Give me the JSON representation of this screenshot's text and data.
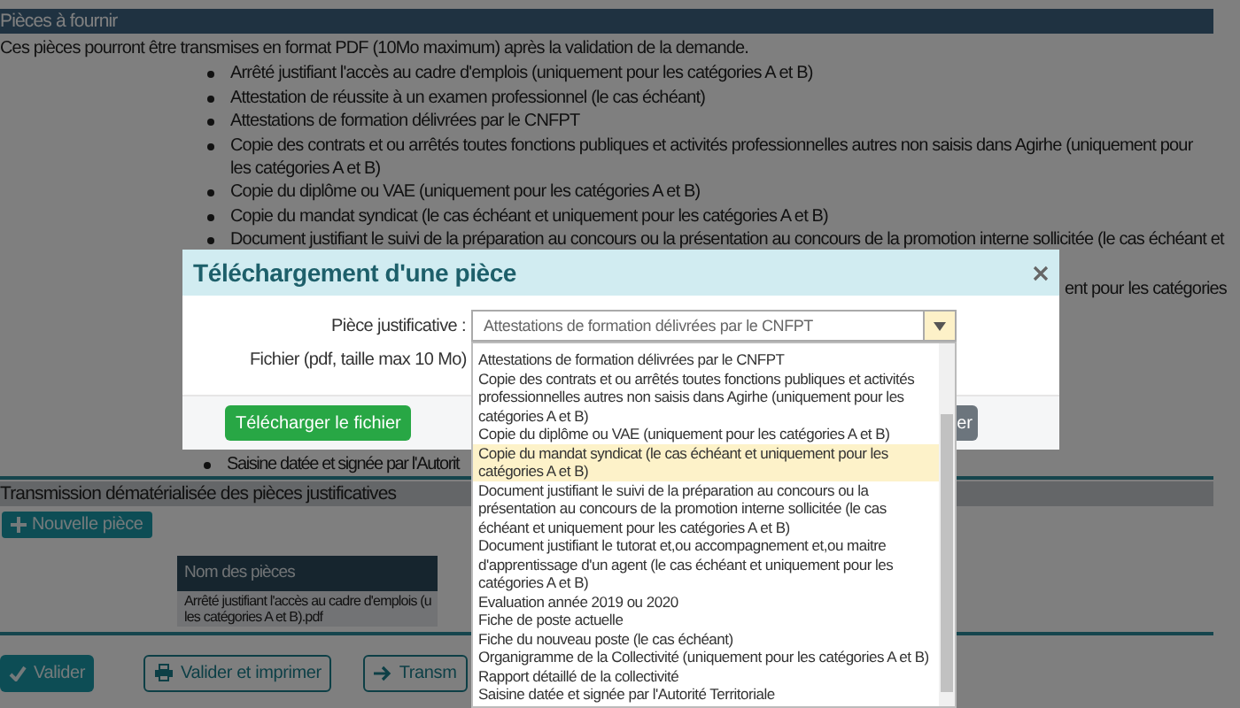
{
  "section_header": "Pièces à fournir",
  "intro": "Ces pièces pourront être transmises en format PDF (10Mo maximum) après la validation de la demande.",
  "documents": [
    "Arrêté justifiant l'accès au cadre d'emplois (uniquement pour les catégories A et B)",
    "Attestation de réussite à un examen professionnel (le cas échéant)",
    "Attestations de formation délivrées par le CNFPT",
    "Copie des contrats et ou arrêtés toutes fonctions publiques et activités professionnelles autres non saisis dans Agirhe (uniquement pour les catégories A et B)",
    "Copie du diplôme ou VAE (uniquement pour les catégories A et B)",
    "Copie du mandat syndicat (le cas échéant et uniquement pour les catégories A et B)",
    "Document justifiant le suivi de la préparation au concours ou la présentation au concours de la promotion interne sollicitée (le cas échéant et"
  ],
  "document_fragment": "ent pour les catégories",
  "last_document": "Saisine datée et signée par l'Autorit",
  "transmission": {
    "header": "Transmission dématérialisée des pièces justificatives",
    "new_button": "Nouvelle pièce",
    "table": {
      "columns": [
        "Nom des pièces"
      ],
      "rows": [
        {
          "lines": [
            "Arrêté justifiant l'accès au cadre d'emplois (u",
            "les catégories A et B).pdf"
          ]
        }
      ]
    }
  },
  "actions": [
    {
      "kind": "primary",
      "label": "Valider"
    },
    {
      "kind": "print",
      "label": "Valider et imprimer"
    },
    {
      "kind": "forward",
      "label": "Transm"
    }
  ],
  "modal": {
    "title": "Téléchargement d'une pièce",
    "fields": [
      {
        "kind": "select",
        "label": "Pièce justificative :",
        "value": "Attestations de formation délivrées par le CNFPT"
      },
      {
        "kind": "file",
        "label": "Fichier (pdf, taille max 10 Mo)"
      }
    ],
    "buttons": [
      {
        "kind": "primary",
        "label": "Télécharger le fichier"
      },
      {
        "kind": "secondary",
        "label": "er"
      }
    ],
    "dropdown": {
      "options": [
        {
          "label": "Attestations de formation délivrées par le CNFPT",
          "selected": false
        },
        {
          "label": "Copie des contrats et ou arrêtés toutes fonctions publiques et activités professionnelles autres non saisis dans Agirhe (uniquement pour les catégories A et B)",
          "selected": false
        },
        {
          "label": "Copie du diplôme ou VAE (uniquement pour les catégories A et B)",
          "selected": false
        },
        {
          "label": "Copie du mandat syndicat (le cas échéant et uniquement pour les catégories A et B)",
          "selected": true
        },
        {
          "label": "Document justifiant le suivi de la préparation au concours ou la présentation au concours de la promotion interne sollicitée (le cas échéant et uniquement pour les catégories A et B)",
          "selected": false
        },
        {
          "label": "Document justifiant le tutorat et,ou accompagnement et,ou maitre d'apprentissage d'un agent (le cas échéant et uniquement pour les catégories A et B)",
          "selected": false
        },
        {
          "label": "Evaluation année 2019 ou 2020",
          "selected": false
        },
        {
          "label": "Fiche de poste actuelle",
          "selected": false
        },
        {
          "label": "Fiche du nouveau poste (le cas échéant)",
          "selected": false
        },
        {
          "label": "Organigramme de la Collectivité (uniquement pour les catégories A et B)",
          "selected": false
        },
        {
          "label": "Rapport détaillé de la collectivité",
          "selected": false
        },
        {
          "label": "Saisine datée et signée par l'Autorité Territoriale",
          "selected": false
        }
      ]
    }
  }
}
